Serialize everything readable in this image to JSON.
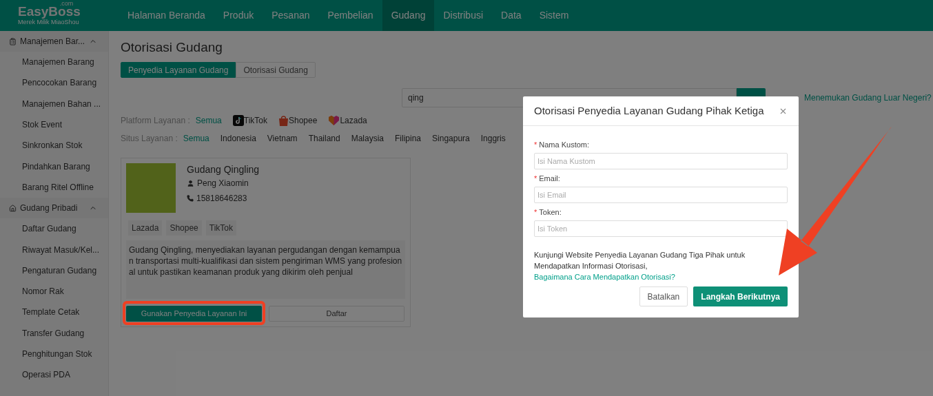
{
  "brand": {
    "name": "EasyBoss",
    "suffix": ".com",
    "tagline": "Merek Milik MiaoShou"
  },
  "nav": [
    {
      "label": "Halaman Beranda",
      "selected": false
    },
    {
      "label": "Produk",
      "selected": false
    },
    {
      "label": "Pesanan",
      "selected": false
    },
    {
      "label": "Pembelian",
      "selected": false
    },
    {
      "label": "Gudang",
      "selected": true
    },
    {
      "label": "Distribusi",
      "selected": false
    },
    {
      "label": "Data",
      "selected": false
    },
    {
      "label": "Sistem",
      "selected": false
    }
  ],
  "sidebar": [
    {
      "label": "Manajemen Bar...",
      "kind": "goods",
      "expanded": true,
      "children": [
        {
          "label": "Manajemen Barang"
        },
        {
          "label": "Pencocokan Barang"
        },
        {
          "label": "Manajemen Bahan ..."
        },
        {
          "label": "Stok Event"
        },
        {
          "label": "Sinkronkan Stok"
        },
        {
          "label": "Pindahkan Barang"
        },
        {
          "label": "Barang Ritel Offline"
        }
      ]
    },
    {
      "label": "Gudang Pribadi",
      "kind": "warehouse",
      "expanded": true,
      "children": [
        {
          "label": "Daftar Gudang"
        },
        {
          "label": "Riwayat Masuk/Kel..."
        },
        {
          "label": "Pengaturan Gudang"
        },
        {
          "label": "Nomor Rak"
        },
        {
          "label": "Template Cetak"
        },
        {
          "label": "Transfer Gudang"
        },
        {
          "label": "Penghitungan Stok"
        },
        {
          "label": "Operasi PDA"
        }
      ]
    }
  ],
  "page": {
    "title": "Otorisasi Gudang",
    "tabs": [
      {
        "label": "Penyedia Layanan Gudang",
        "selected": true
      },
      {
        "label": "Otorisasi Gudang",
        "selected": false
      }
    ],
    "search": {
      "value": "qing"
    },
    "help_link": "Menemukan Gudang Luar Negeri?",
    "filters": [
      {
        "label": "Platform Layanan :",
        "options": [
          {
            "label": "Semua",
            "kind": "text",
            "selected": true
          },
          {
            "label": "TikTok",
            "kind": "tiktok",
            "selected": false
          },
          {
            "label": "Shopee",
            "kind": "shopee",
            "selected": false
          },
          {
            "label": "Lazada",
            "kind": "lazada",
            "selected": false
          }
        ]
      },
      {
        "label": "Situs Layanan :",
        "options": [
          {
            "label": "Semua",
            "kind": "text",
            "selected": true
          },
          {
            "label": "Indonesia",
            "kind": "text",
            "selected": false
          },
          {
            "label": "Vietnam",
            "kind": "text",
            "selected": false
          },
          {
            "label": "Thailand",
            "kind": "text",
            "selected": false
          },
          {
            "label": "Malaysia",
            "kind": "text",
            "selected": false
          },
          {
            "label": "Filipina",
            "kind": "text",
            "selected": false
          },
          {
            "label": "Singapura",
            "kind": "text",
            "selected": false
          },
          {
            "label": "Inggris",
            "kind": "text",
            "selected": false
          }
        ]
      }
    ],
    "card": {
      "name": "Gudang Qingling",
      "contact": "Peng Xiaomin",
      "phone": "15818646283",
      "tags": [
        "Lazada",
        "Shopee",
        "TikTok"
      ],
      "description": "Gudang Qingling, menyediakan layanan pergudangan dengan kemampuan transportasi multi-kualifikasi dan sistem pengiriman WMS yang profesional untuk pastikan keamanan produk yang dikirim oleh penjual",
      "buttons": [
        {
          "label": "Gunakan Penyedia Layanan Ini",
          "kind": "primary",
          "highlighted": true
        },
        {
          "label": "Daftar",
          "kind": "default",
          "highlighted": false
        }
      ]
    }
  },
  "modal": {
    "title": "Otorisasi Penyedia Layanan Gudang Pihak Ketiga",
    "required_mark": "*",
    "fields": [
      {
        "label": "Nama Kustom:",
        "placeholder": "Isi Nama Kustom",
        "required": true
      },
      {
        "label": "Email:",
        "placeholder": "Isi Email",
        "required": true
      },
      {
        "label": "Token:",
        "placeholder": "Isi Token",
        "required": true
      }
    ],
    "note": "Kunjungi Website Penyedia Layanan Gudang Tiga Pihak untuk Mendapatkan Informasi Otorisasi,",
    "link": "Bagaimana Cara Mendapatkan Otorisasi?",
    "buttons": [
      {
        "label": "Batalkan",
        "kind": "default"
      },
      {
        "label": "Langkah Berikutnya",
        "kind": "primary"
      }
    ],
    "pointer_arrow": true
  }
}
